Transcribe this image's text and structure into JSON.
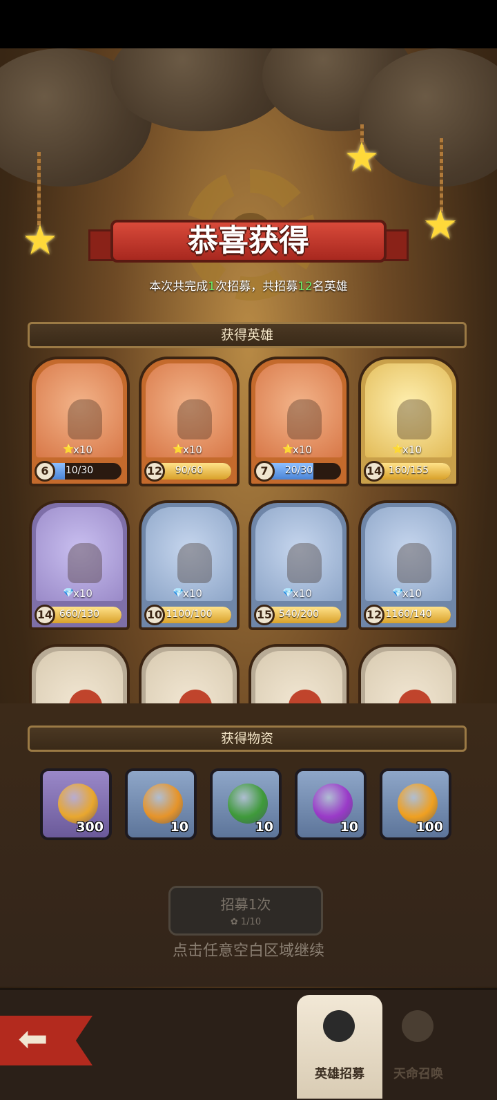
{
  "title": "恭喜获得",
  "summary": {
    "prefix": "本次共完成",
    "recruit_times": "1",
    "middle": "次招募，共招募",
    "hero_total": "12",
    "suffix": "名英雄"
  },
  "sections": {
    "heroes": "获得英雄",
    "items": "获得物资"
  },
  "heroes": [
    {
      "rarity": "orange",
      "level": "6",
      "count": "x10",
      "progress": "10/30",
      "fraction": 0.33
    },
    {
      "rarity": "orange",
      "level": "12",
      "count": "x10",
      "progress": "90/60",
      "fraction": 1.0
    },
    {
      "rarity": "orange",
      "level": "7",
      "count": "x10",
      "progress": "20/30",
      "fraction": 0.67
    },
    {
      "rarity": "gold",
      "level": "14",
      "count": "x10",
      "progress": "160/155",
      "fraction": 1.0
    },
    {
      "rarity": "purple",
      "level": "14",
      "count": "x10",
      "progress": "660/130",
      "fraction": 1.0
    },
    {
      "rarity": "blue",
      "level": "10",
      "count": "x10",
      "progress": "1100/100",
      "fraction": 1.0
    },
    {
      "rarity": "blue",
      "level": "15",
      "count": "x10",
      "progress": "540/200",
      "fraction": 1.0
    },
    {
      "rarity": "blue",
      "level": "12",
      "count": "x10",
      "progress": "1160/140",
      "fraction": 1.0
    }
  ],
  "items": [
    {
      "icon": "gold-coin-icon",
      "amount": "300",
      "color": "#e9a72e"
    },
    {
      "icon": "shield-shard-icon",
      "amount": "10",
      "color": "#e6942a"
    },
    {
      "icon": "bow-shard-icon",
      "amount": "10",
      "color": "#3f9a3a"
    },
    {
      "icon": "shuriken-shard-icon",
      "amount": "10",
      "color": "#9a3ac8"
    },
    {
      "icon": "spade-coin-icon",
      "amount": "100",
      "color": "#f0a020"
    }
  ],
  "recruit_button": {
    "label": "招募1次",
    "cost": "1/10"
  },
  "continue_hint": "点击任意空白区域继续",
  "nav": {
    "tabs": [
      {
        "label": "英雄招募",
        "active": true
      },
      {
        "label": "天命召唤",
        "active": false
      }
    ]
  }
}
